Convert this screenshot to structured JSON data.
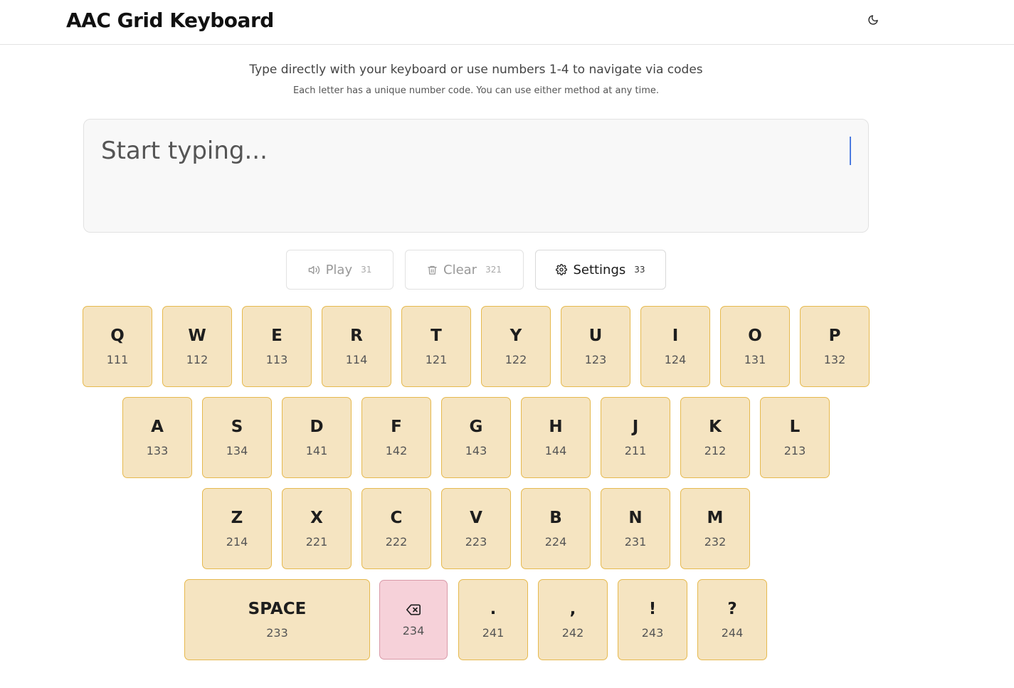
{
  "header": {
    "title": "AAC Grid Keyboard",
    "theme_toggle_icon": "moon-icon"
  },
  "intro": {
    "main": "Type directly with your keyboard or use numbers 1-4 to navigate via codes",
    "sub": "Each letter has a unique number code. You can use either method at any time."
  },
  "text_area": {
    "placeholder": "Start typing...",
    "value": ""
  },
  "controls": {
    "play": {
      "label": "Play",
      "code": "31",
      "icon": "speaker-icon",
      "enabled": false
    },
    "clear": {
      "label": "Clear",
      "code": "321",
      "icon": "trash-icon",
      "enabled": false
    },
    "settings": {
      "label": "Settings",
      "code": "33",
      "icon": "gear-icon",
      "enabled": true
    }
  },
  "keyboard": {
    "row1": [
      {
        "label": "Q",
        "code": "111"
      },
      {
        "label": "W",
        "code": "112"
      },
      {
        "label": "E",
        "code": "113"
      },
      {
        "label": "R",
        "code": "114"
      },
      {
        "label": "T",
        "code": "121"
      },
      {
        "label": "Y",
        "code": "122"
      },
      {
        "label": "U",
        "code": "123"
      },
      {
        "label": "I",
        "code": "124"
      },
      {
        "label": "O",
        "code": "131"
      },
      {
        "label": "P",
        "code": "132"
      }
    ],
    "row2": [
      {
        "label": "A",
        "code": "133"
      },
      {
        "label": "S",
        "code": "134"
      },
      {
        "label": "D",
        "code": "141"
      },
      {
        "label": "F",
        "code": "142"
      },
      {
        "label": "G",
        "code": "143"
      },
      {
        "label": "H",
        "code": "144"
      },
      {
        "label": "J",
        "code": "211"
      },
      {
        "label": "K",
        "code": "212"
      },
      {
        "label": "L",
        "code": "213"
      }
    ],
    "row3": [
      {
        "label": "Z",
        "code": "214"
      },
      {
        "label": "X",
        "code": "221"
      },
      {
        "label": "C",
        "code": "222"
      },
      {
        "label": "V",
        "code": "223"
      },
      {
        "label": "B",
        "code": "224"
      },
      {
        "label": "N",
        "code": "231"
      },
      {
        "label": "M",
        "code": "232"
      }
    ],
    "row4": {
      "space": {
        "label": "SPACE",
        "code": "233"
      },
      "backspace": {
        "icon": "backspace-icon",
        "code": "234"
      },
      "punctuation": [
        {
          "label": ".",
          "code": "241"
        },
        {
          "label": ",",
          "code": "242"
        },
        {
          "label": "!",
          "code": "243"
        },
        {
          "label": "?",
          "code": "244"
        }
      ]
    }
  },
  "colors": {
    "key_bg": "#f5e4c1",
    "key_border": "#e6b94e",
    "backspace_bg": "#f6d1d9",
    "caret": "#4c7be0"
  }
}
